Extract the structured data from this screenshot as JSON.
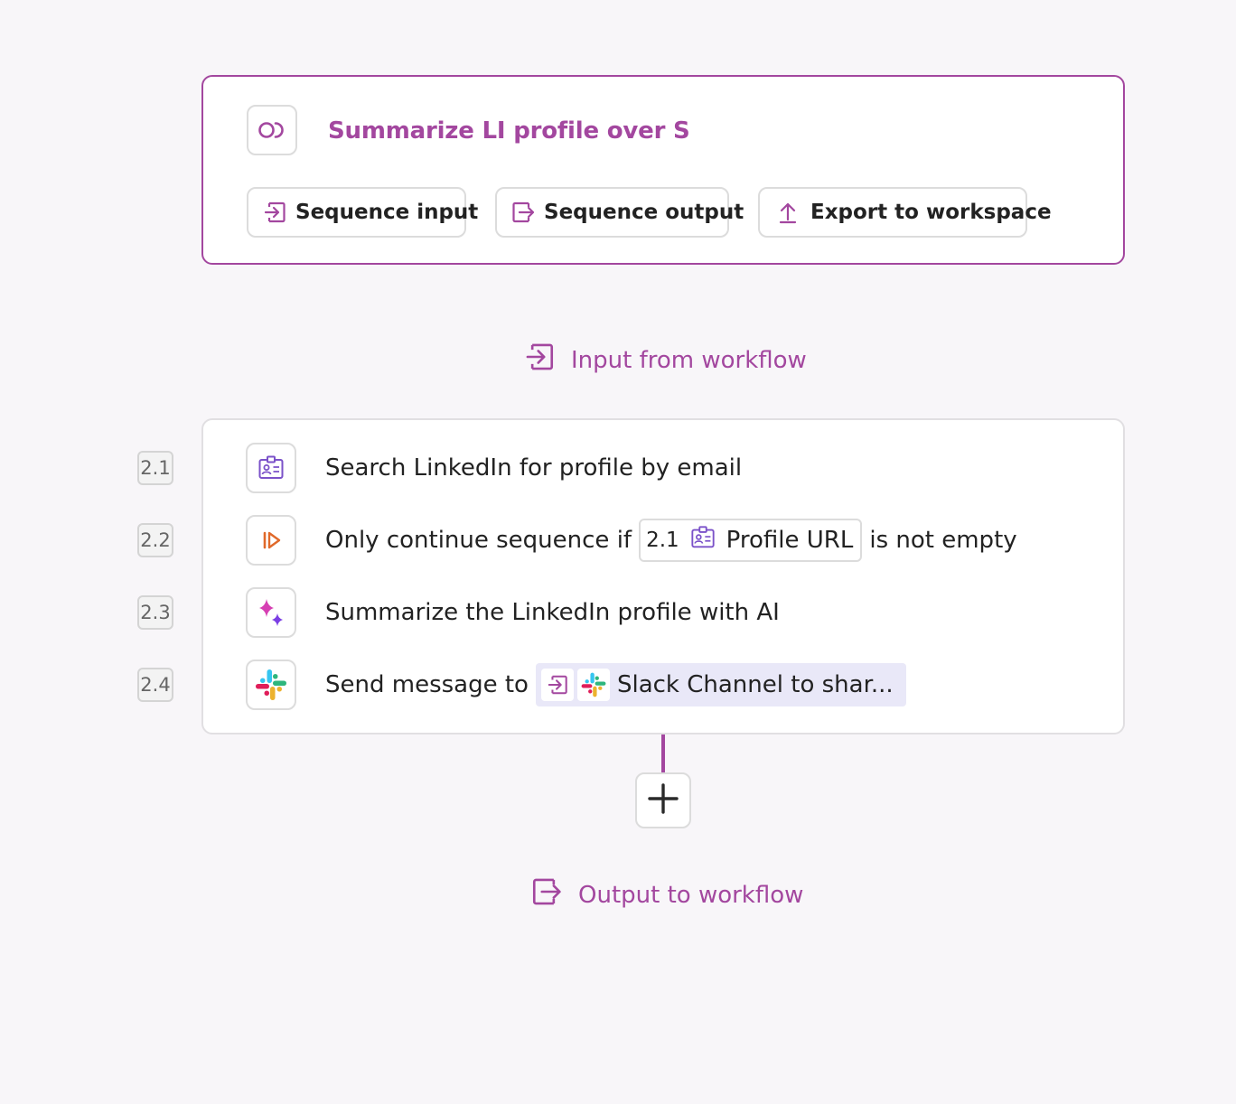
{
  "sequence": {
    "title": "Summarize LI profile over Slack",
    "buttons": {
      "sequence_input": "Sequence input",
      "sequence_output": "Sequence output",
      "export": "Export to workspace"
    }
  },
  "flow": {
    "input_label": "Input from workflow",
    "output_label": "Output to workflow"
  },
  "steps": [
    {
      "number": "2.1",
      "icon": "profile-card-icon",
      "text": "Search LinkedIn for profile by email"
    },
    {
      "number": "2.2",
      "icon": "conditional-continue-icon",
      "text_before": "Only continue sequence if",
      "ref_number": "2.1",
      "ref_field": "Profile URL",
      "text_after": "is not empty"
    },
    {
      "number": "2.3",
      "icon": "ai-sparkle-icon",
      "text": "Summarize the LinkedIn profile with AI"
    },
    {
      "number": "2.4",
      "icon": "slack-icon",
      "text_before": "Send message to",
      "chip_text": "Slack Channel to shar..."
    }
  ],
  "colors": {
    "accent": "#a3479f",
    "chip_background": "#e9e8f8",
    "conditional_orange": "#e0692a",
    "ai_pink": "#d63fb3",
    "ai_violet": "#7b3fe4"
  }
}
